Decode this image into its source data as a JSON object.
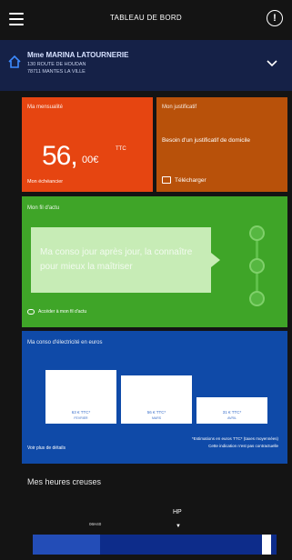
{
  "header": {
    "title": "TABLEAU DE BORD",
    "menu_icon": "menu-icon",
    "profile_icon": "user-icon",
    "profile_glyph": "!"
  },
  "address": {
    "name": "Mme MARINA LATOURNERIE",
    "line1": "130 ROUTE DE HOUDAN",
    "line2": "78711 MANTES LA VILLE",
    "home_icon": "home-icon",
    "expand_icon": "chevron-down-icon"
  },
  "mensualite": {
    "label": "Ma mensualité",
    "amount": "56,",
    "decimals": "00€",
    "ttc": "TTC",
    "footer": "Mon échéancier",
    "color": "#e64511"
  },
  "justificatif": {
    "label": "Mon justificatif",
    "message": "Besoin d'un justificatif de domicile",
    "download_label": "Télécharger",
    "color": "#b8510a"
  },
  "fil": {
    "label": "Mon fil d'actu",
    "card_text": "Ma conso jour après jour, la connaître pour mieux la maîtriser",
    "link": "Accéder à mon fil d'actu",
    "color": "#3fa528"
  },
  "conso": {
    "label": "Ma conso d'électricité en euros",
    "note1": "*Estimations en euros TTC* (taxes moyennées)",
    "note2": "Cette indication n'est pas contractuelle",
    "details": "Voir plus de détails",
    "color": "#0f4aa8"
  },
  "chart_data": {
    "type": "bar",
    "categories": [
      "FEVRIER",
      "MARS",
      "AVRIL"
    ],
    "value_labels": [
      "63 € TTC*",
      "56 € TTC*",
      "31 € TTC*"
    ],
    "values": [
      63,
      56,
      31
    ],
    "ylim": [
      0,
      70
    ]
  },
  "heures_creuses": {
    "title": "Mes heures creuses",
    "hp_label": "HP",
    "time_label": "06H40",
    "arrow": "▼"
  }
}
